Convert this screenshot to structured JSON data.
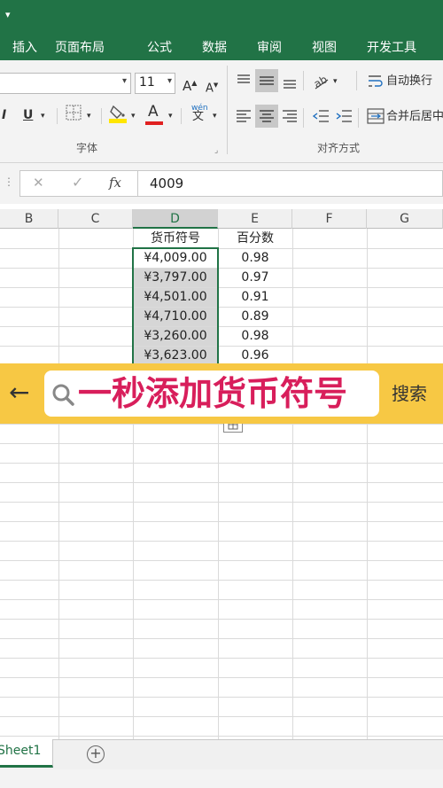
{
  "quick_access": {
    "caret": "▾"
  },
  "ribbon_tabs": [
    "插入",
    "页面布局",
    "公式",
    "数据",
    "审阅",
    "视图",
    "开发工具"
  ],
  "ribbon": {
    "font_size": "11",
    "grow_font": "A",
    "shrink_font": "A",
    "italic": "I",
    "underline": "U",
    "font_color_letter": "A",
    "phonetic_top": "wén",
    "phonetic_bottom": "文",
    "font_group": "字体",
    "wrap_text": "自动换行",
    "merge_center": "合并后居中",
    "align_group": "对齐方式",
    "accent_red": "#e02020",
    "accent_yellow": "#ffe600"
  },
  "formula_bar": {
    "cancel": "✕",
    "enter": "✓",
    "fx": "fx",
    "value": "4009"
  },
  "columns": [
    "B",
    "C",
    "D",
    "E",
    "F",
    "G"
  ],
  "selected_column": "D",
  "table": {
    "header_d": "货币符号",
    "header_e": "百分数",
    "rows": [
      {
        "d": "¥4,009.00",
        "e": "0.98"
      },
      {
        "d": "¥3,797.00",
        "e": "0.97"
      },
      {
        "d": "¥4,501.00",
        "e": "0.91"
      },
      {
        "d": "¥4,710.00",
        "e": "0.89"
      },
      {
        "d": "¥3,260.00",
        "e": "0.98"
      },
      {
        "d": "¥3,623.00",
        "e": "0.96"
      }
    ]
  },
  "overlay": {
    "back_icon": "←",
    "query": "一秒添加货币符号",
    "search_button": "搜索"
  },
  "sheet_tabs": {
    "active": "Sheet1",
    "add": "+"
  }
}
